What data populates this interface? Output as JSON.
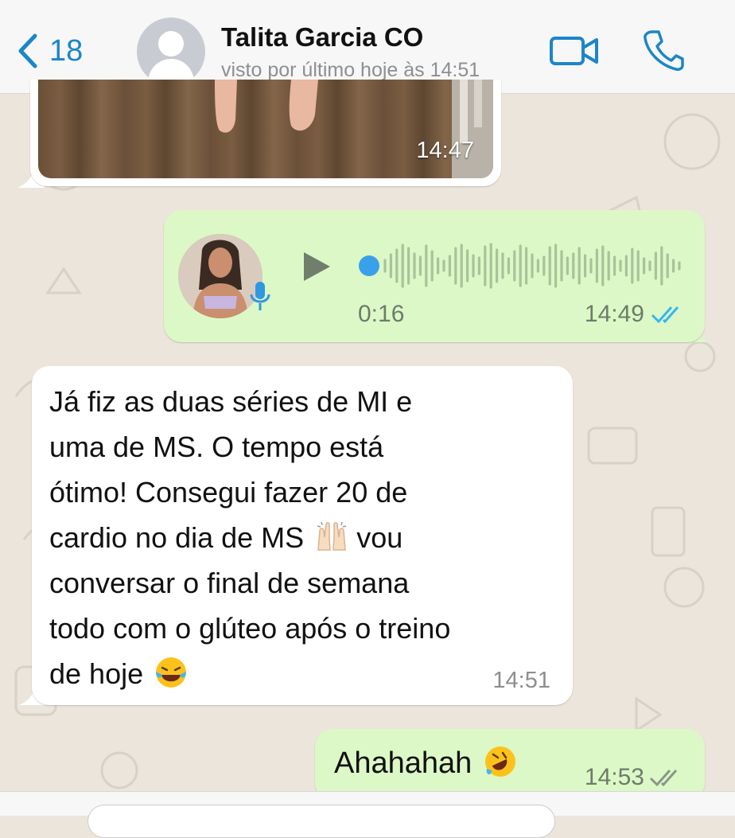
{
  "header": {
    "back_count": "18",
    "contact_name": "Talita Garcia CO",
    "status": "visto por último hoje às 14:51"
  },
  "messages": [
    {
      "type": "image",
      "direction": "incoming",
      "time": "14:47"
    },
    {
      "type": "voice",
      "direction": "outgoing",
      "duration": "0:16",
      "time": "14:49",
      "status": "read"
    },
    {
      "type": "text",
      "direction": "incoming",
      "time": "14:51",
      "lines": [
        "Já fiz as duas séries de MI e",
        "uma de MS. O tempo está",
        "ótimo! Consegui fazer 20 de",
        "cardio no dia de MS",
        "vou",
        "conversar o final de semana",
        "todo com o glúteo após o treino",
        "de hoje"
      ],
      "emojis": [
        "raising-hands-emoji",
        "laughing-tears-emoji"
      ]
    },
    {
      "type": "text",
      "direction": "outgoing",
      "text": "Ahahahah",
      "emoji": "rolling-laughing-emoji",
      "time": "14:53",
      "status": "delivered"
    }
  ],
  "colors": {
    "accent": "#1b86c9",
    "outgoing_bubble": "#dcf8c6",
    "incoming_bubble": "#ffffff",
    "background": "#ece5dc",
    "read_tick": "#34b7f1"
  }
}
